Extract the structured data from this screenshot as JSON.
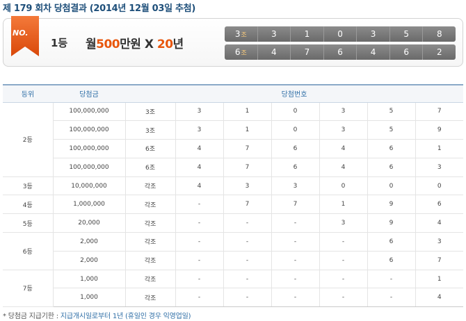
{
  "title": "제 179 회차 당첨결과 (2014년 12월 03일 추첨)",
  "winner": {
    "badge": "NO.",
    "rank": "1등",
    "prize_prefix": "월",
    "prize_amount": "500",
    "prize_unit": "만원 X ",
    "prize_years": "20",
    "prize_years_unit": "년",
    "numbers": [
      {
        "group": "3",
        "group_unit": "조",
        "digits": [
          "3",
          "1",
          "0",
          "3",
          "5",
          "8"
        ]
      },
      {
        "group": "6",
        "group_unit": "조",
        "digits": [
          "4",
          "7",
          "6",
          "4",
          "6",
          "2"
        ]
      }
    ]
  },
  "table": {
    "headers": {
      "rank": "등위",
      "prize": "당첨금",
      "numbers": "당첨번호"
    },
    "groups": [
      {
        "rank": "2등",
        "rows": [
          {
            "prize": "100,000,000",
            "group": "3조",
            "digits": [
              "3",
              "1",
              "0",
              "3",
              "5",
              "7"
            ]
          },
          {
            "prize": "100,000,000",
            "group": "3조",
            "digits": [
              "3",
              "1",
              "0",
              "3",
              "5",
              "9"
            ]
          },
          {
            "prize": "100,000,000",
            "group": "6조",
            "digits": [
              "4",
              "7",
              "6",
              "4",
              "6",
              "1"
            ]
          },
          {
            "prize": "100,000,000",
            "group": "6조",
            "digits": [
              "4",
              "7",
              "6",
              "4",
              "6",
              "3"
            ]
          }
        ]
      },
      {
        "rank": "3등",
        "rows": [
          {
            "prize": "10,000,000",
            "group": "각조",
            "digits": [
              "4",
              "3",
              "3",
              "0",
              "0",
              "0"
            ]
          }
        ]
      },
      {
        "rank": "4등",
        "rows": [
          {
            "prize": "1,000,000",
            "group": "각조",
            "digits": [
              "-",
              "7",
              "7",
              "1",
              "9",
              "6"
            ]
          }
        ]
      },
      {
        "rank": "5등",
        "rows": [
          {
            "prize": "20,000",
            "group": "각조",
            "digits": [
              "-",
              "-",
              "-",
              "3",
              "9",
              "4"
            ]
          }
        ]
      },
      {
        "rank": "6등",
        "rows": [
          {
            "prize": "2,000",
            "group": "각조",
            "digits": [
              "-",
              "-",
              "-",
              "-",
              "6",
              "3"
            ]
          },
          {
            "prize": "2,000",
            "group": "각조",
            "digits": [
              "-",
              "-",
              "-",
              "-",
              "6",
              "7"
            ]
          }
        ]
      },
      {
        "rank": "7등",
        "rows": [
          {
            "prize": "1,000",
            "group": "각조",
            "digits": [
              "-",
              "-",
              "-",
              "-",
              "-",
              "1"
            ]
          },
          {
            "prize": "1,000",
            "group": "각조",
            "digits": [
              "-",
              "-",
              "-",
              "-",
              "-",
              "4"
            ]
          }
        ]
      }
    ]
  },
  "footnote": {
    "label": "* 당첨금 지급기한 : ",
    "value": "지급개시일로부터 1년 (휴일인 경우 익영업일)"
  },
  "colors": {
    "title": "#1e4f7a",
    "accent_orange": "#e8560c",
    "header_blue": "#2e6ea6",
    "number_box": "#7a7a7a"
  }
}
